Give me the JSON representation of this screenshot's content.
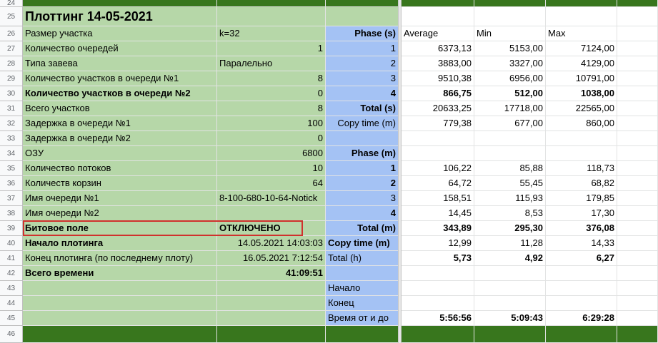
{
  "rows": [
    {
      "n": "24",
      "cells": [
        "",
        "",
        "",
        "",
        "",
        "",
        ""
      ]
    },
    {
      "n": "25",
      "cells": [
        "Плоттинг 14-05-2021",
        "",
        "",
        "",
        "",
        "",
        ""
      ]
    },
    {
      "n": "26",
      "cells": [
        "Размер участка",
        "k=32",
        "Phase (s)",
        "Average",
        "Min",
        "Max",
        ""
      ]
    },
    {
      "n": "27",
      "cells": [
        "Количество очередей",
        "1",
        "1",
        "6373,13",
        "5153,00",
        "7124,00",
        ""
      ]
    },
    {
      "n": "28",
      "cells": [
        "Типа завева",
        "Паралельно",
        "2",
        "3883,00",
        "3327,00",
        "4129,00",
        ""
      ]
    },
    {
      "n": "29",
      "cells": [
        "Количество участков в очереди №1",
        "8",
        "3",
        "9510,38",
        "6956,00",
        "10791,00",
        ""
      ]
    },
    {
      "n": "30",
      "cells": [
        "Количество участков в очереди №2",
        "0",
        "4",
        "866,75",
        "512,00",
        "1038,00",
        ""
      ]
    },
    {
      "n": "31",
      "cells": [
        "Всего участков",
        "8",
        "Total (s)",
        "20633,25",
        "17718,00",
        "22565,00",
        ""
      ]
    },
    {
      "n": "32",
      "cells": [
        "Задержка в очереди №1",
        "100",
        "Copy time (m)",
        "779,38",
        "677,00",
        "860,00",
        ""
      ]
    },
    {
      "n": "33",
      "cells": [
        "Задержка в очереди №2",
        "0",
        "",
        "",
        "",
        "",
        ""
      ]
    },
    {
      "n": "34",
      "cells": [
        "ОЗУ",
        "6800",
        "Phase (m)",
        "",
        "",
        "",
        ""
      ]
    },
    {
      "n": "35",
      "cells": [
        "Количество потоков",
        "10",
        "1",
        "106,22",
        "85,88",
        "118,73",
        ""
      ]
    },
    {
      "n": "36",
      "cells": [
        "Количеств корзин",
        "64",
        "2",
        "64,72",
        "55,45",
        "68,82",
        ""
      ]
    },
    {
      "n": "37",
      "cells": [
        "Имя очереди №1",
        "8-100-680-10-64-Notick",
        "3",
        "158,51",
        "115,93",
        "179,85",
        ""
      ]
    },
    {
      "n": "38",
      "cells": [
        "Имя очереди №2",
        "",
        "4",
        "14,45",
        "8,53",
        "17,30",
        ""
      ]
    },
    {
      "n": "39",
      "cells": [
        "Битовое поле",
        "ОТКЛЮЧЕНО",
        "Total (m)",
        "343,89",
        "295,30",
        "376,08",
        ""
      ]
    },
    {
      "n": "40",
      "cells": [
        "Начало плотинга",
        "14.05.2021 14:03:03",
        "Copy time (m)",
        "12,99",
        "11,28",
        "14,33",
        ""
      ]
    },
    {
      "n": "41",
      "cells": [
        "Конец плотинга (по последнему плоту)",
        "16.05.2021 7:12:54",
        "Total (h)",
        "5,73",
        "4,92",
        "6,27",
        ""
      ]
    },
    {
      "n": "42",
      "cells": [
        "Всего времени",
        "41:09:51",
        "",
        "",
        "",
        "",
        ""
      ]
    },
    {
      "n": "43",
      "cells": [
        "",
        "",
        "Начало",
        "",
        "",
        "",
        ""
      ]
    },
    {
      "n": "44",
      "cells": [
        "",
        "",
        "Конец",
        "",
        "",
        "",
        ""
      ]
    },
    {
      "n": "45",
      "cells": [
        "",
        "",
        "Время от и до",
        "5:56:56",
        "5:09:43",
        "6:29:28",
        ""
      ]
    },
    {
      "n": "46",
      "cells": [
        "",
        "",
        "",
        "",
        "",
        "",
        ""
      ]
    }
  ],
  "colors": {
    "green": "#b6d7a8",
    "blue": "#a4c2f4",
    "dark_green": "#38761d",
    "highlight_border": "#d0312d"
  }
}
